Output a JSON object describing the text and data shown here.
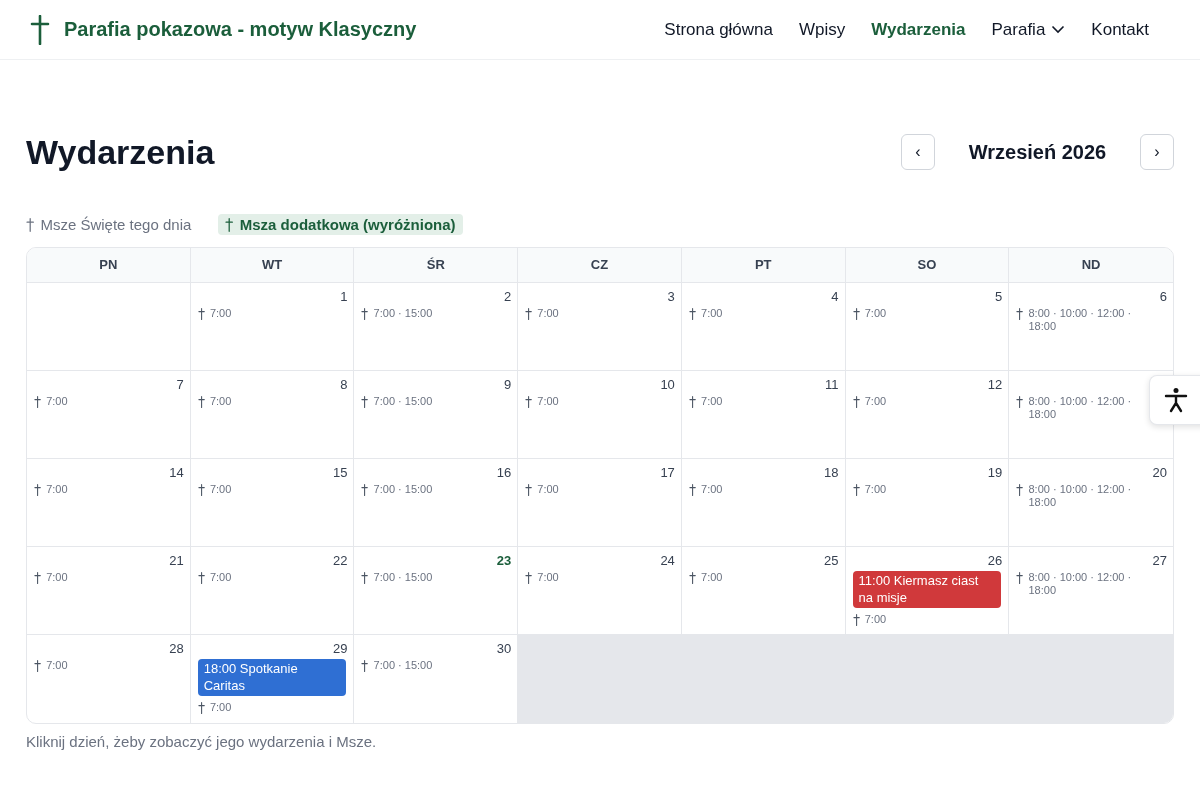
{
  "site": {
    "title": "Parafia pokazowa - motyw Klasyczny"
  },
  "nav": [
    {
      "label": "Strona główna",
      "selected": false,
      "dropdown": false
    },
    {
      "label": "Wpisy",
      "selected": false,
      "dropdown": false
    },
    {
      "label": "Wydarzenia",
      "selected": true,
      "dropdown": false
    },
    {
      "label": "Parafia",
      "selected": false,
      "dropdown": true
    },
    {
      "label": "Kontakt",
      "selected": false,
      "dropdown": false
    }
  ],
  "page_title": "Wydarzenia",
  "month_nav": {
    "prev": "‹",
    "month": "Wrzesień 2026",
    "next": "›"
  },
  "legend": [
    {
      "kind": "regular",
      "label": "Msze Święte tego dnia"
    },
    {
      "kind": "highlighted",
      "label": "Msza dodatkowa (wyróżniona)"
    }
  ],
  "calendar": {
    "weekdays": [
      "PN",
      "WT",
      "ŚR",
      "CZ",
      "PT",
      "SO",
      "ND"
    ],
    "weeks": [
      [
        {
          "kind": "empty"
        },
        {
          "kind": "day",
          "day": "1",
          "today": false,
          "masses": "7:00"
        },
        {
          "kind": "day",
          "day": "2",
          "today": false,
          "masses": "7:00 · 15:00"
        },
        {
          "kind": "day",
          "day": "3",
          "today": false,
          "masses": "7:00"
        },
        {
          "kind": "day",
          "day": "4",
          "today": false,
          "masses": "7:00"
        },
        {
          "kind": "day",
          "day": "5",
          "today": false,
          "masses": "7:00"
        },
        {
          "kind": "day",
          "day": "6",
          "today": false,
          "masses": "8:00 · 10:00 · 12:00 · 18:00"
        }
      ],
      [
        {
          "kind": "day",
          "day": "7",
          "today": false,
          "masses": "7:00"
        },
        {
          "kind": "day",
          "day": "8",
          "today": false,
          "masses": "7:00"
        },
        {
          "kind": "day",
          "day": "9",
          "today": false,
          "masses": "7:00 · 15:00"
        },
        {
          "kind": "day",
          "day": "10",
          "today": false,
          "masses": "7:00"
        },
        {
          "kind": "day",
          "day": "11",
          "today": false,
          "masses": "7:00"
        },
        {
          "kind": "day",
          "day": "12",
          "today": false,
          "masses": "7:00"
        },
        {
          "kind": "day",
          "masses": "8:00 · 10:00 · 12:00 · 18:00"
        }
      ],
      [
        {
          "kind": "day",
          "day": "14",
          "today": false,
          "masses": "7:00"
        },
        {
          "kind": "day",
          "day": "15",
          "today": false,
          "masses": "7:00"
        },
        {
          "kind": "day",
          "day": "16",
          "today": false,
          "masses": "7:00 · 15:00"
        },
        {
          "kind": "day",
          "day": "17",
          "today": false,
          "masses": "7:00"
        },
        {
          "kind": "day",
          "day": "18",
          "today": false,
          "masses": "7:00"
        },
        {
          "kind": "day",
          "day": "19",
          "today": false,
          "masses": "7:00"
        },
        {
          "kind": "day",
          "day": "20",
          "today": false,
          "masses": "8:00 · 10:00 · 12:00 · 18:00"
        }
      ],
      [
        {
          "kind": "day",
          "day": "21",
          "today": false,
          "masses": "7:00"
        },
        {
          "kind": "day",
          "day": "22",
          "today": false,
          "masses": "7:00"
        },
        {
          "kind": "day",
          "day": "23",
          "today": true,
          "masses": "7:00 · 15:00"
        },
        {
          "kind": "day",
          "day": "24",
          "today": false,
          "masses": "7:00"
        },
        {
          "kind": "day",
          "day": "25",
          "today": false,
          "masses": "7:00"
        },
        {
          "kind": "day",
          "day": "26",
          "today": false,
          "events": [
            {
              "label": "11:00 Kiermasz ciast na misje",
              "color": "#d0393b"
            }
          ],
          "masses": "7:00"
        },
        {
          "kind": "day",
          "day": "27",
          "today": false,
          "masses": "8:00 · 10:00 · 12:00 · 18:00"
        }
      ],
      [
        {
          "kind": "day",
          "day": "28",
          "today": false,
          "masses": "7:00"
        },
        {
          "kind": "day",
          "day": "29",
          "today": false,
          "events": [
            {
              "label": "18:00 Spotkanie Caritas",
              "color": "#2f6fd3"
            }
          ],
          "masses": "7:00"
        },
        {
          "kind": "day",
          "day": "30",
          "today": false,
          "masses": "7:00 · 15:00"
        },
        {
          "kind": "outside"
        },
        {
          "kind": "outside"
        },
        {
          "kind": "outside"
        },
        {
          "kind": "outside"
        }
      ]
    ]
  },
  "hint": "Kliknij dzień, żeby zobaczyć jego wydarzenia i Msze."
}
